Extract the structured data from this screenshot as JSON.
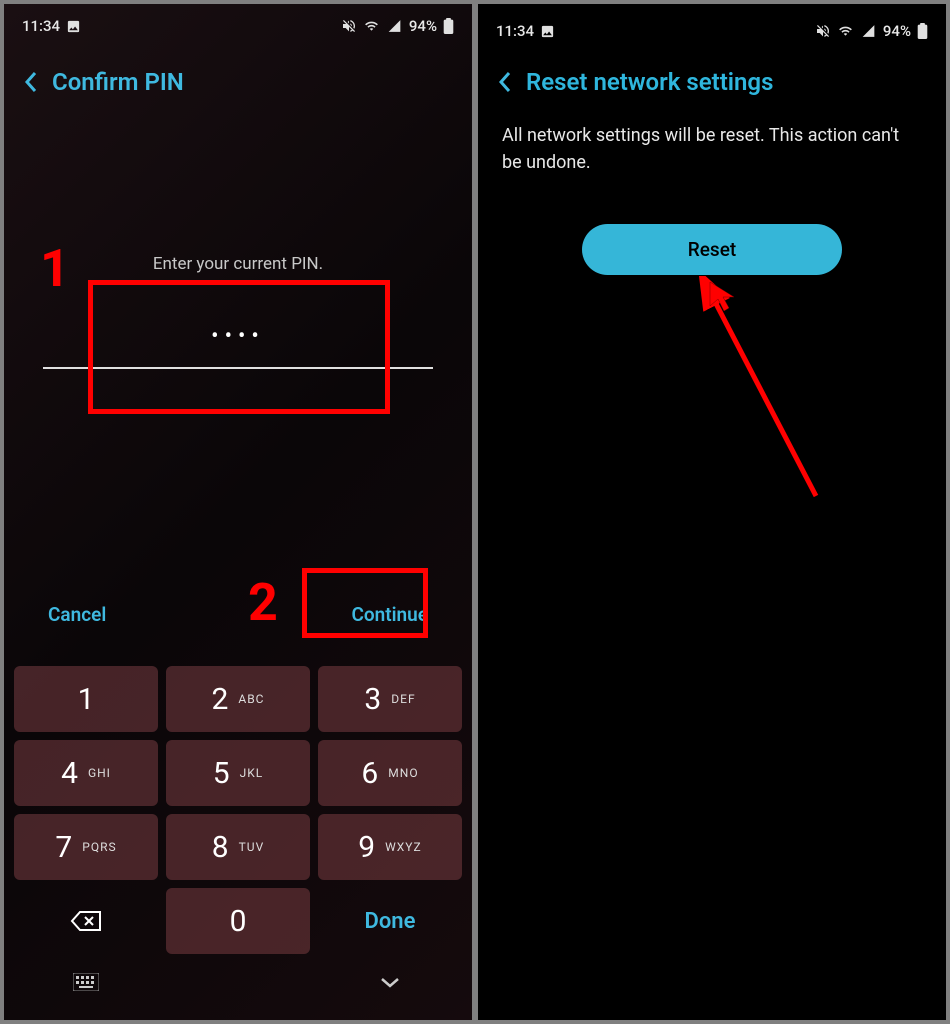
{
  "status": {
    "time": "11:34",
    "battery": "94%"
  },
  "left": {
    "title": "Confirm PIN",
    "prompt": "Enter your current PIN.",
    "dots": "••••",
    "cancel": "Cancel",
    "cont": "Continue",
    "keypad": [
      {
        "d": "1",
        "l": ""
      },
      {
        "d": "2",
        "l": "ABC"
      },
      {
        "d": "3",
        "l": "DEF"
      },
      {
        "d": "4",
        "l": "GHI"
      },
      {
        "d": "5",
        "l": "JKL"
      },
      {
        "d": "6",
        "l": "MNO"
      },
      {
        "d": "7",
        "l": "PQRS"
      },
      {
        "d": "8",
        "l": "TUV"
      },
      {
        "d": "9",
        "l": "WXYZ"
      },
      {
        "d": "0",
        "l": ""
      }
    ],
    "done": "Done",
    "anno1": "1",
    "anno2": "2"
  },
  "right": {
    "title": "Reset network settings",
    "body": "All network settings will be reset. This action can't be undone.",
    "reset": "Reset"
  }
}
